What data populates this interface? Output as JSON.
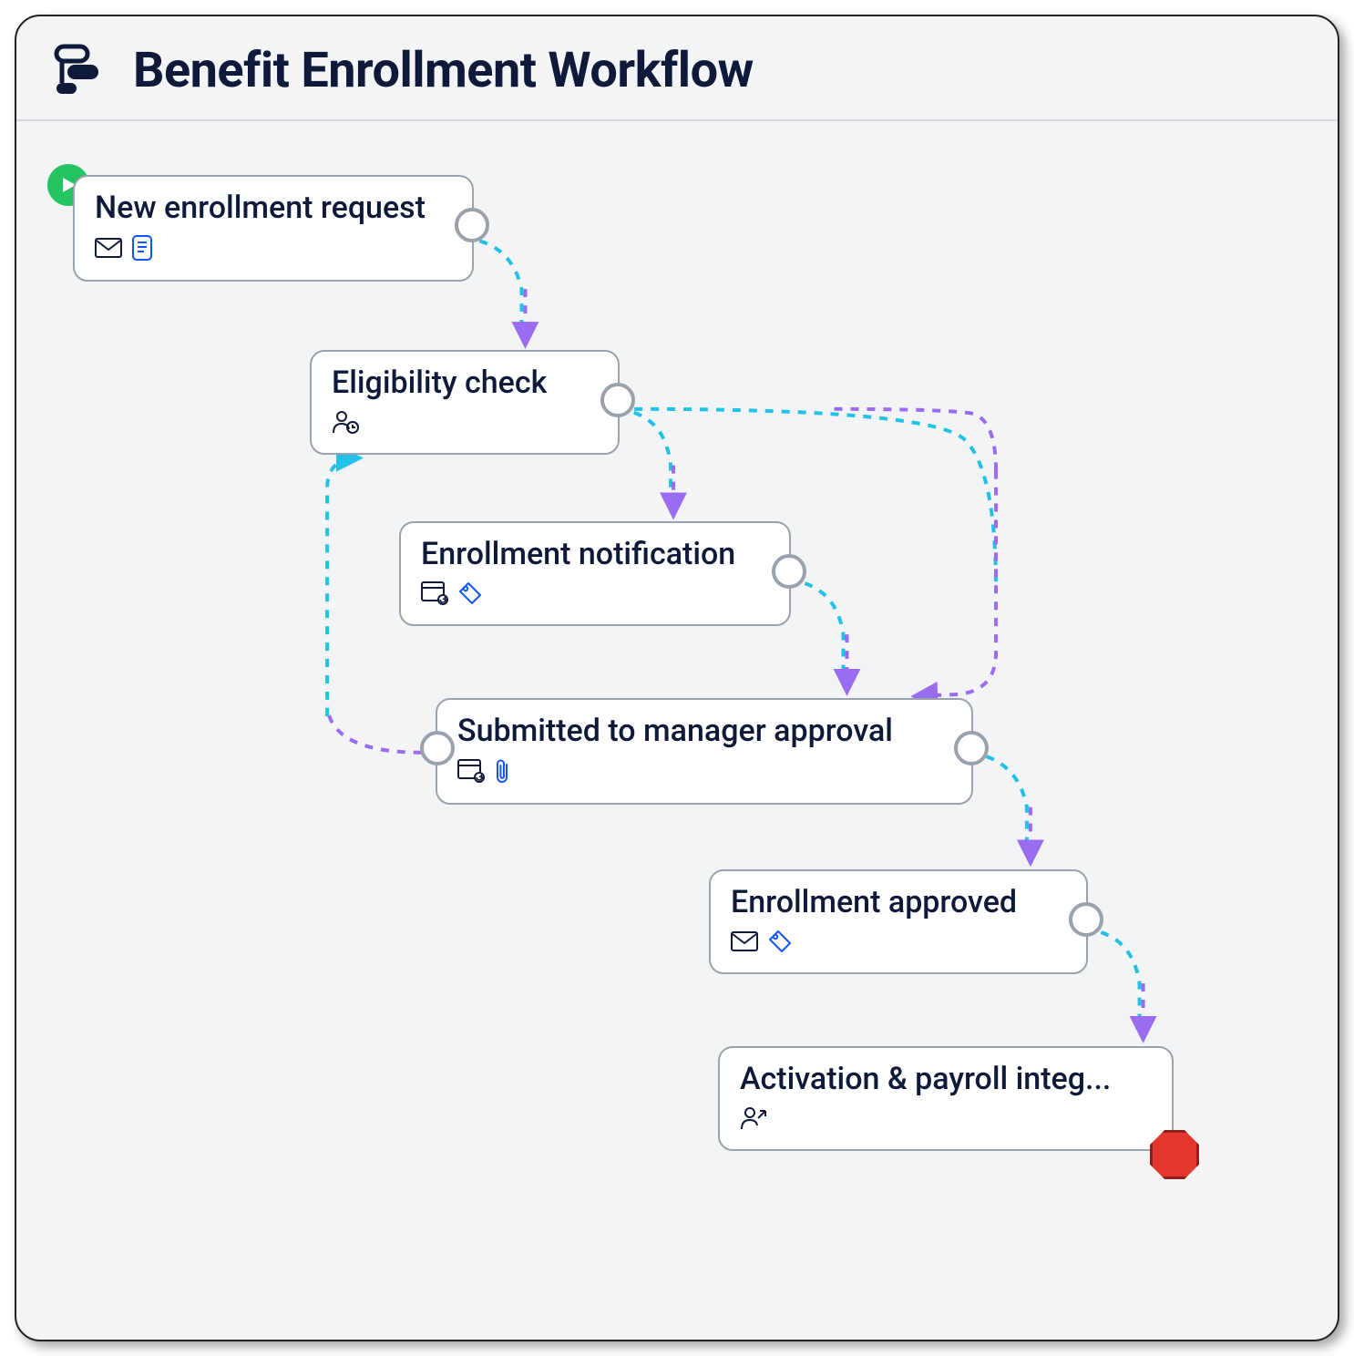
{
  "header": {
    "title": "Benefit Enrollment Workflow"
  },
  "nodes": {
    "n1": {
      "label": "New enrollment request",
      "icons": [
        "mail-icon",
        "form-icon"
      ]
    },
    "n2": {
      "label": "Eligibility check",
      "icons": [
        "person-clock-icon"
      ]
    },
    "n3": {
      "label": "Enrollment notification",
      "icons": [
        "webform-add-icon",
        "tag-icon"
      ]
    },
    "n4": {
      "label": "Submitted to manager approval",
      "icons": [
        "webform-add-icon",
        "paperclip-icon"
      ]
    },
    "n5": {
      "label": "Enrollment approved",
      "icons": [
        "mail-icon",
        "tag-icon"
      ]
    },
    "n6": {
      "label": "Activation & payroll integ...",
      "icons": [
        "person-share-icon"
      ]
    }
  },
  "badges": {
    "start": "play-icon",
    "end": "stop-icon"
  },
  "colors": {
    "cyan": "#22c2e8",
    "purple": "#9a6cf1",
    "navy": "#0f1a3a",
    "blue": "#1356ff"
  }
}
